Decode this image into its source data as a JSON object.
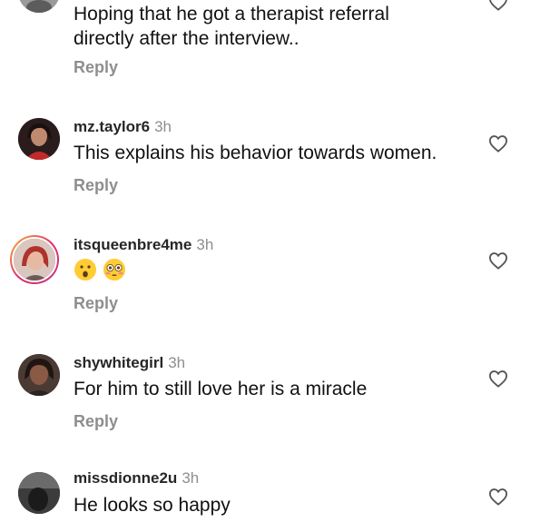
{
  "comments": [
    {
      "username": "",
      "time": "",
      "text_lines": [
        "Hoping that he got a therapist referral",
        "directly after the interview.."
      ],
      "reply": "Reply"
    },
    {
      "username": "mz.taylor6",
      "time": "3h",
      "text": "This explains his behavior towards women.",
      "reply": "Reply"
    },
    {
      "username": "itsqueenbre4me",
      "time": "3h",
      "emojis": [
        "hushed-face-emoji",
        "flushed-face-emoji"
      ],
      "reply": "Reply"
    },
    {
      "username": "shywhitegirl",
      "time": "3h",
      "text": "For him to still love her is a miracle",
      "reply": "Reply"
    },
    {
      "username": "missdionne2u",
      "time": "3h",
      "text": "He looks so happy",
      "reply": ""
    }
  ],
  "icons": {
    "like": "heart-outline-icon"
  },
  "colors": {
    "secondary_text": "#8e8e8e",
    "story_ring": "#e1306c"
  }
}
